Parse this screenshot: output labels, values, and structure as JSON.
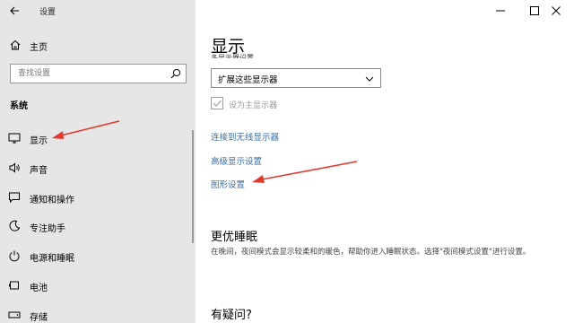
{
  "window": {
    "title": "设置",
    "controls": [
      "minimize-icon",
      "maximize-icon",
      "close-icon"
    ]
  },
  "sidebar": {
    "home_label": "主页",
    "search": {
      "placeholder": "查找设置",
      "icon": "search-icon"
    },
    "section_title": "系统",
    "items": [
      {
        "label": "显示",
        "icon": "monitor-icon"
      },
      {
        "label": "声音",
        "icon": "speaker-icon"
      },
      {
        "label": "通知和操作",
        "icon": "notification-icon"
      },
      {
        "label": "专注助手",
        "icon": "moon-icon"
      },
      {
        "label": "电源和睡眠",
        "icon": "power-icon"
      },
      {
        "label": "电池",
        "icon": "battery-icon"
      },
      {
        "label": "存储",
        "icon": "storage-icon"
      }
    ]
  },
  "main": {
    "title": "显示",
    "clipped_label": "多显示器设置",
    "dropdown": {
      "value": "扩展这些显示器"
    },
    "checkbox": {
      "label": "设为主显示器",
      "checked": true,
      "disabled": true
    },
    "links": [
      "连接到无线显示器",
      "高级显示设置",
      "图形设置"
    ],
    "sleep_section": {
      "title": "更优睡眠",
      "description": "在晚间，夜间模式会显示较柔和的暖色，帮助你进入睡眠状态。选择\"夜间模式设置\"进行设置。"
    },
    "question_title": "有疑问?"
  },
  "annotations": {
    "arrow_color": "#e03a2e"
  }
}
